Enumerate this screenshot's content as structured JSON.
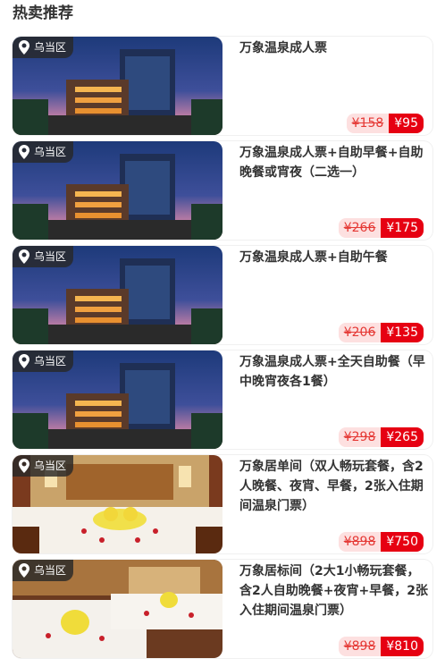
{
  "section": {
    "title": "热卖推荐"
  },
  "items": [
    {
      "location": "乌当区",
      "title": "万象温泉成人票",
      "old_price": "¥158",
      "price": "¥95",
      "image": "hotel-exterior"
    },
    {
      "location": "乌当区",
      "title": "万象温泉成人票+自助早餐+自助晚餐或宵夜（二选一）",
      "old_price": "¥266",
      "price": "¥175",
      "image": "hotel-exterior"
    },
    {
      "location": "乌当区",
      "title": "万象温泉成人票+自助午餐",
      "old_price": "¥206",
      "price": "¥135",
      "image": "hotel-exterior"
    },
    {
      "location": "乌当区",
      "title": "万象温泉成人票+全天自助餐（早中晚宵夜各1餐）",
      "old_price": "¥298",
      "price": "¥265",
      "image": "hotel-exterior"
    },
    {
      "location": "乌当区",
      "title": "万象居单间（双人畅玩套餐，含2人晚餐、夜宵、早餐，2张入住期间温泉门票）",
      "old_price": "¥898",
      "price": "¥750",
      "image": "hotel-room-single"
    },
    {
      "location": "乌当区",
      "title": "万象居标间（2大1小畅玩套餐，含2人自助晚餐+夜宵+早餐，2张入住期间温泉门票）",
      "old_price": "¥898",
      "price": "¥810",
      "image": "hotel-room-twin"
    }
  ]
}
